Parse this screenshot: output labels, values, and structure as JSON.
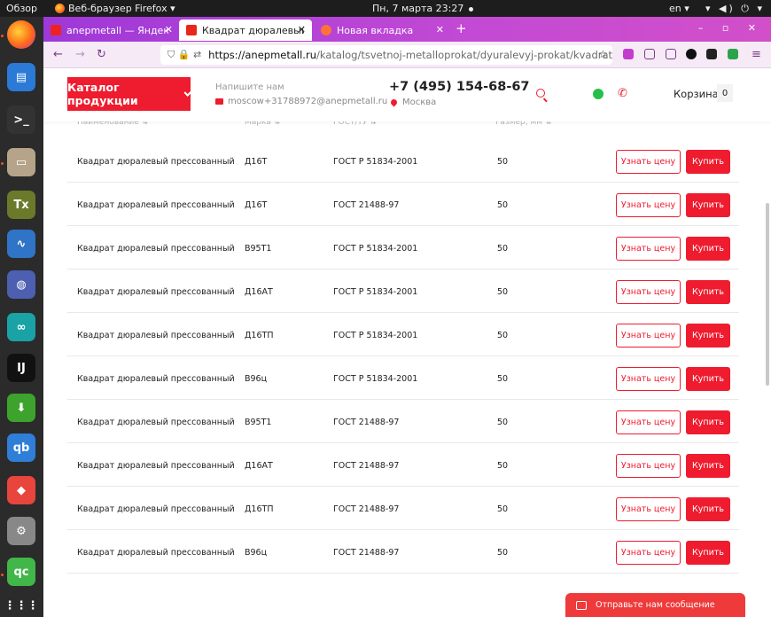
{
  "os": {
    "activities": "Обзор",
    "app_name": "Веб-браузер Firefox ▾",
    "clock": "Пн, 7 марта  23:27",
    "lang": "en ▾",
    "tray": "▾ ◀) ⏻ ▾"
  },
  "dock": [
    {
      "name": "firefox-icon",
      "glyph": "",
      "color": "#ff7139"
    },
    {
      "name": "writer-icon",
      "glyph": "▤",
      "color": "#2a7ad6"
    },
    {
      "name": "terminal-icon",
      "glyph": ">_",
      "color": "#333"
    },
    {
      "name": "files-icon",
      "glyph": "▭",
      "color": "#b5a48a"
    },
    {
      "name": "texstudio-icon",
      "glyph": "Tx",
      "color": "#6a7a2a"
    },
    {
      "name": "monitor-icon",
      "glyph": "∿",
      "color": "#2f74c7"
    },
    {
      "name": "eclipse-icon",
      "glyph": "◍",
      "color": "#4c5fb0"
    },
    {
      "name": "arduino-icon",
      "glyph": "∞",
      "color": "#1aa3a6"
    },
    {
      "name": "intellij-icon",
      "glyph": "IJ",
      "color": "#111"
    },
    {
      "name": "download-icon",
      "glyph": "⬇",
      "color": "#3da32c"
    },
    {
      "name": "qbittorrent-icon",
      "glyph": "qb",
      "color": "#2f7ed8"
    },
    {
      "name": "anydesk-icon",
      "glyph": "◆",
      "color": "#e8453c"
    },
    {
      "name": "settings-icon",
      "glyph": "⚙",
      "color": "#888"
    },
    {
      "name": "qtcreator-icon",
      "glyph": "qc",
      "color": "#41b649"
    },
    {
      "name": "apps-grid-icon",
      "glyph": "⋮⋮⋮",
      "color": "transparent"
    }
  ],
  "browser": {
    "tabs": [
      {
        "label": "anepmetall — Яндекс: на",
        "favicon": "#e22"
      },
      {
        "label": "Квадрат дюралевый — а",
        "favicon": "#e8261a"
      },
      {
        "label": "Новая вкладка",
        "favicon": "#ff7139"
      }
    ],
    "url_host": "https://anepmetall.ru",
    "url_path": "/katalog/tsvetnoj-metalloprokat/dyuralevyj-prokat/kvadrat-dyura"
  },
  "header": {
    "catalog_label": "Каталог продукции",
    "write_label": "Напишите нам",
    "email": "moscow+31788972@anepmetall.ru",
    "phone": "+7 (495) 154-68-67",
    "city": "Москва",
    "cart_label": "Корзина",
    "cart_count": "0"
  },
  "table": {
    "headers": [
      "Наименование ⇅",
      "Марка ⇅",
      "ГОСТ/ТУ ⇅",
      "Размер, мм ⇅"
    ],
    "price_label": "Узнать цену",
    "buy_label": "Купить",
    "rows": [
      {
        "name": "Квадрат дюралевый прессованный",
        "grade": "Д16Т",
        "gost": "ГОСТ Р 51834-2001",
        "size": "50"
      },
      {
        "name": "Квадрат дюралевый прессованный",
        "grade": "Д16Т",
        "gost": "ГОСТ 21488-97",
        "size": "50"
      },
      {
        "name": "Квадрат дюралевый прессованный",
        "grade": "В95Т1",
        "gost": "ГОСТ Р 51834-2001",
        "size": "50"
      },
      {
        "name": "Квадрат дюралевый прессованный",
        "grade": "Д16АТ",
        "gost": "ГОСТ Р 51834-2001",
        "size": "50"
      },
      {
        "name": "Квадрат дюралевый прессованный",
        "grade": "Д16ТП",
        "gost": "ГОСТ Р 51834-2001",
        "size": "50"
      },
      {
        "name": "Квадрат дюралевый прессованный",
        "grade": "В96ц",
        "gost": "ГОСТ Р 51834-2001",
        "size": "50"
      },
      {
        "name": "Квадрат дюралевый прессованный",
        "grade": "В95Т1",
        "gost": "ГОСТ 21488-97",
        "size": "50"
      },
      {
        "name": "Квадрат дюралевый прессованный",
        "grade": "Д16АТ",
        "gost": "ГОСТ 21488-97",
        "size": "50"
      },
      {
        "name": "Квадрат дюралевый прессованный",
        "grade": "Д16ТП",
        "gost": "ГОСТ 21488-97",
        "size": "50"
      },
      {
        "name": "Квадрат дюралевый прессованный",
        "grade": "В96ц",
        "gost": "ГОСТ 21488-97",
        "size": "50"
      }
    ]
  },
  "chat": {
    "label": "Отправьте нам сообщение"
  }
}
